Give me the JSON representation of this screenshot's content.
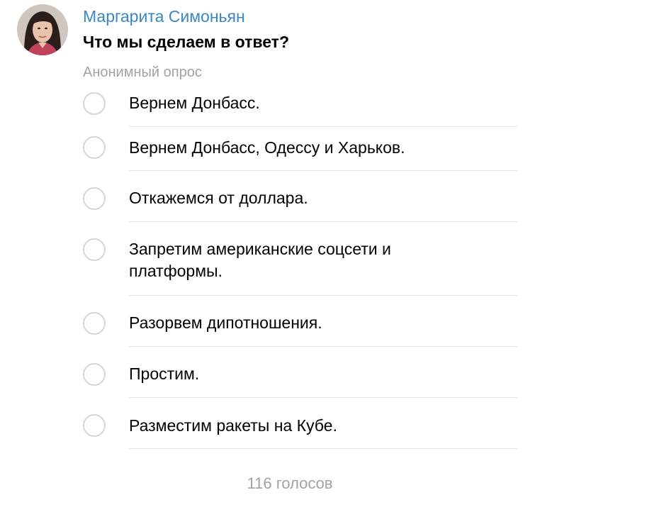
{
  "message": {
    "author": "Маргарита Симоньян",
    "avatar_icon": "profile-photo",
    "author_color": "#3a87c7"
  },
  "poll": {
    "question": "Что мы сделаем в ответ?",
    "type_label": "Анонимный опрос",
    "options": [
      {
        "label": "Вернем Донбасс."
      },
      {
        "label": "Вернем Донбасс, Одессу и Харьков."
      },
      {
        "label": "Откажемся от доллара."
      },
      {
        "label": "Запретим американские соцсети и платформы."
      },
      {
        "label": "Разорвем дипотношения."
      },
      {
        "label": "Простим."
      },
      {
        "label": "Разместим ракеты на Кубе."
      }
    ],
    "votes_label": "116 голосов"
  }
}
